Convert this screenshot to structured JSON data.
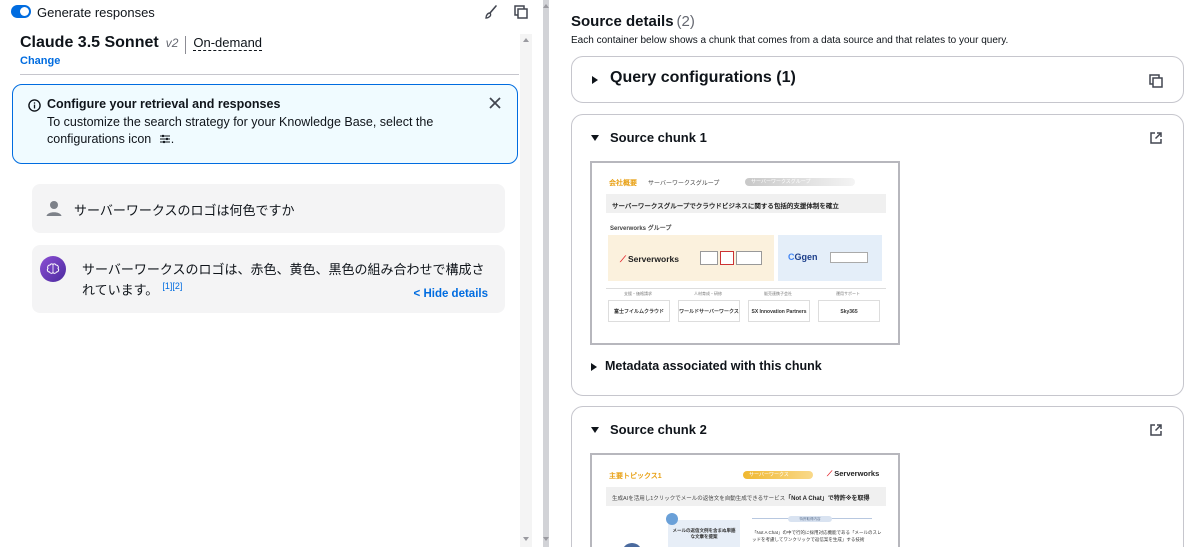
{
  "topbar": {
    "toggle_label": "Generate responses",
    "toggle_on": true,
    "brush_icon": "brush-icon",
    "copy_icon": "copy-icon"
  },
  "model": {
    "name": "Claude 3.5 Sonnet",
    "version": "v2",
    "mode": "On-demand",
    "change_label": "Change"
  },
  "alert": {
    "title": "Configure your retrieval and responses",
    "body": "To customize the search strategy for your Knowledge Base, select the configurations icon",
    "body_suffix": ".",
    "icon": "info-icon",
    "close_icon": "close-icon"
  },
  "chat": {
    "user_message": "サーバーワークスのロゴは何色ですか",
    "bot_message": "サーバーワークスのロゴは、赤色、黄色、黒色の組み合わせで構成されています。",
    "citations": "[1][2]",
    "hide_details_label": "< Hide details"
  },
  "source_details": {
    "title": "Source details",
    "count": "(2)",
    "description": "Each container below shows a chunk that comes from a data source and that relates to your query.",
    "query_config_label": "Query configurations (1)",
    "chunks": [
      {
        "label": "Source chunk 1",
        "metadata_label": "Metadata associated with this chunk",
        "slide": {
          "heading": "会社概要",
          "subheading": "サーバーワークスグループ",
          "pill": "サーバーワークスグループ",
          "banner": "サーバーワークスグループでクラウドビジネスに関する包括的支援体制を確立",
          "group_label": "Serverworks グループ",
          "logo_a": "Serverworks",
          "logo_b": "Ggen",
          "columns": [
            {
              "label": "支援・価格請求",
              "name": "富士フイルムクラウド"
            },
            {
              "label": "人材育成・研修",
              "name": "ワールドサーバーワークス"
            },
            {
              "label": "販売連携子会社",
              "name": "SX Innovation Partners"
            },
            {
              "label": "運用サポート",
              "name": "Sky365"
            }
          ]
        }
      },
      {
        "label": "Source chunk 2",
        "slide": {
          "heading": "主要トピックス1",
          "pill": "サーバーワークス",
          "logo": "Serverworks",
          "banner_prefix": "生成AIを活用し1クリックでメールの返信文を自動生成できるサービス",
          "banner_main": "「Not A Chat」で特許※を取得",
          "box_text": "メールの返信文例を含まぬ単語な文章を提案",
          "pill2": "特許取得内容",
          "text": "「Not A Chat」の中で行的に採用対応機能である「メールのスレッドを考慮してワンクリックで返信案を生成」する技術"
        }
      }
    ]
  }
}
